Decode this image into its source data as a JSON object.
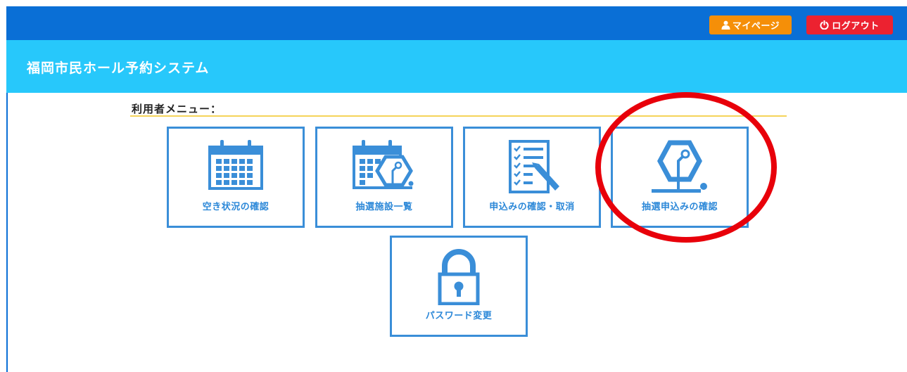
{
  "topbar": {
    "mypage_label": "マイページ",
    "logout_label": "ログアウト"
  },
  "header": {
    "title": "福岡市民ホール予約システム"
  },
  "menu": {
    "section_label": "利用者メニュー：",
    "tiles": [
      {
        "label": "空き状況の確認",
        "icon": "calendar-icon"
      },
      {
        "label": "抽選施設一覧",
        "icon": "calendar-lottery-icon"
      },
      {
        "label": "申込みの確認・取消",
        "icon": "checklist-pen-icon"
      },
      {
        "label": "抽選申込みの確認",
        "icon": "lottery-machine-icon"
      },
      {
        "label": "パスワード変更",
        "icon": "lock-icon"
      }
    ]
  },
  "colors": {
    "topbar": "#0a6fd6",
    "header": "#27c8fb",
    "mypage": "#f58f08",
    "logout": "#ec2230",
    "tile_border": "#3a8ed8",
    "highlight": "#e8000a"
  }
}
